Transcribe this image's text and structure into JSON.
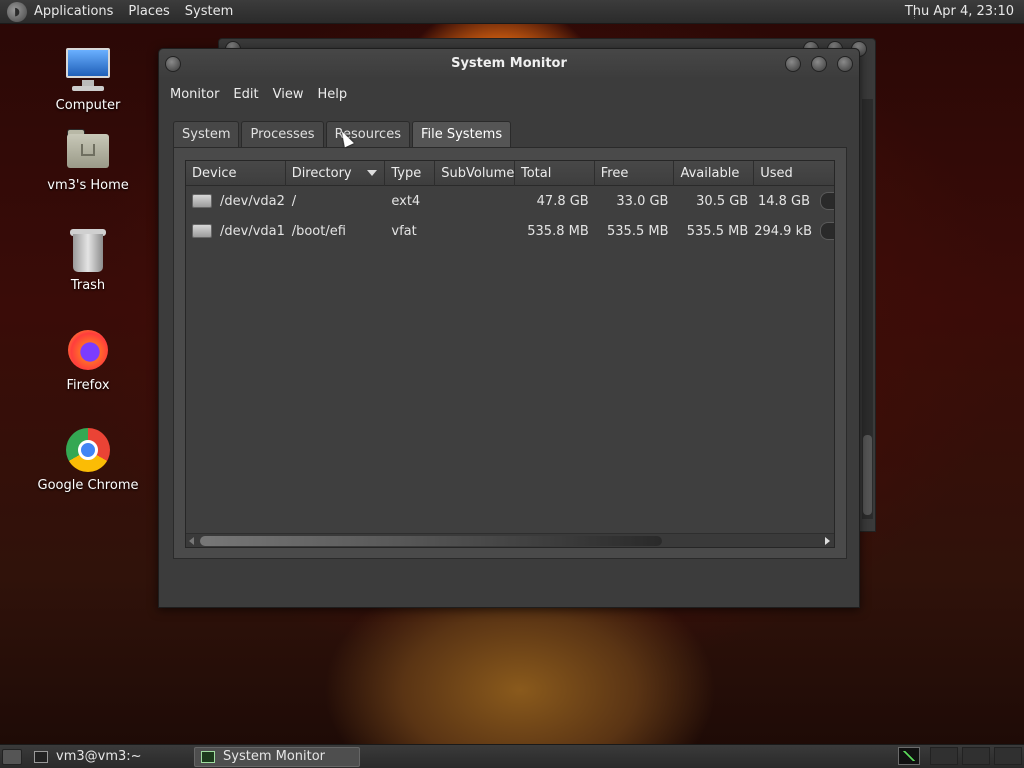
{
  "top_panel": {
    "menus": [
      "Applications",
      "Places",
      "System"
    ],
    "clock": "Thu Apr  4, 23:10"
  },
  "desktop": {
    "icons": [
      {
        "label": "Computer",
        "icon": "computer-icon"
      },
      {
        "label": "vm3's Home",
        "icon": "home-folder-icon"
      },
      {
        "label": "Trash",
        "icon": "trash-icon"
      },
      {
        "label": "Firefox",
        "icon": "firefox-icon"
      },
      {
        "label": "Google Chrome",
        "icon": "chrome-icon"
      }
    ]
  },
  "window": {
    "title": "System Monitor",
    "menus": [
      "Monitor",
      "Edit",
      "View",
      "Help"
    ],
    "tabs": [
      "System",
      "Processes",
      "Resources",
      "File Systems"
    ],
    "active_tab": "File Systems",
    "columns": [
      "Device",
      "Directory",
      "Type",
      "SubVolume",
      "Total",
      "Free",
      "Available",
      "Used"
    ],
    "sort_column": "Directory",
    "rows": [
      {
        "device": "/dev/vda2",
        "directory": "/",
        "type": "ext4",
        "subvolume": "",
        "total": "47.8 GB",
        "free": "33.0 GB",
        "available": "30.5 GB",
        "used": "14.8 GB"
      },
      {
        "device": "/dev/vda1",
        "directory": "/boot/efi",
        "type": "vfat",
        "subvolume": "",
        "total": "535.8 MB",
        "free": "535.5 MB",
        "available": "535.5 MB",
        "used": "294.9 kB"
      }
    ]
  },
  "bottom_panel": {
    "tasks": [
      {
        "label": "vm3@vm3:~",
        "icon": "terminal-icon",
        "active": false
      },
      {
        "label": "System Monitor",
        "icon": "system-monitor-icon",
        "active": true
      }
    ]
  },
  "colors": {
    "panel_bg": "#2b2b2b",
    "window_bg": "#3c3c3c",
    "active_tab": "#555555"
  }
}
